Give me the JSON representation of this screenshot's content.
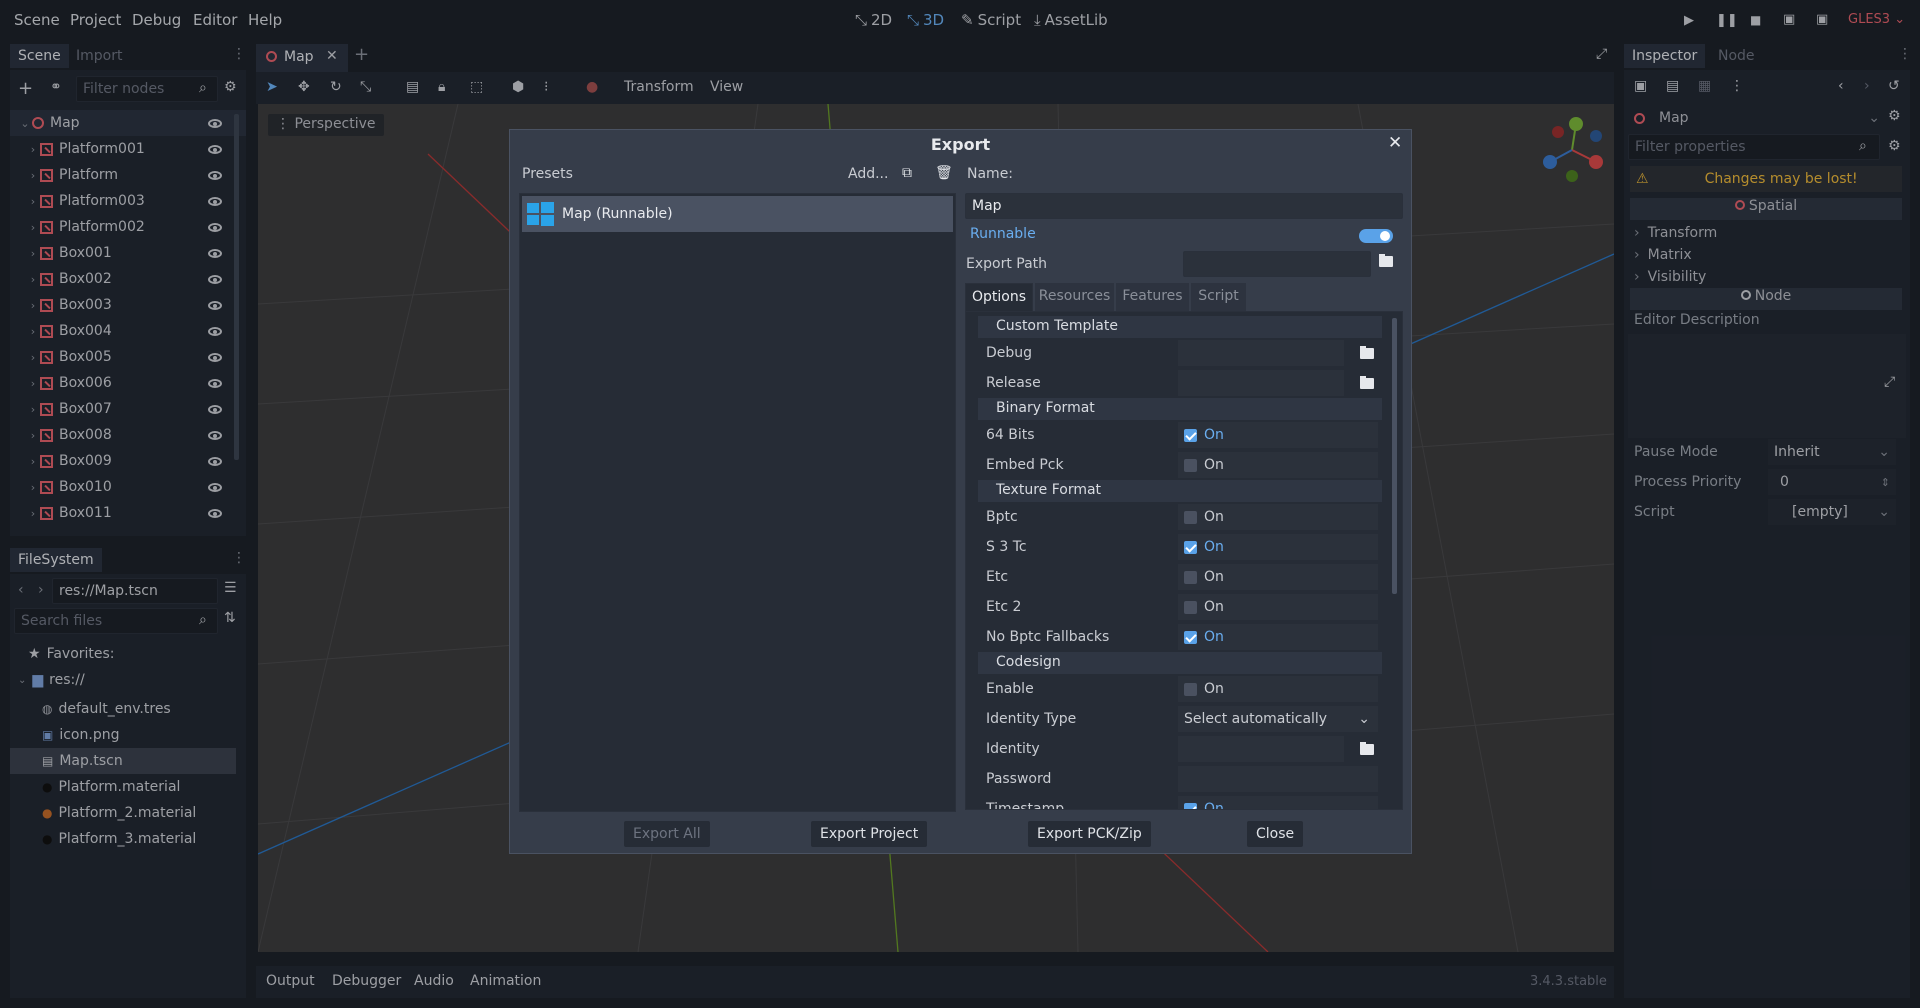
{
  "menubar": {
    "items": [
      "Scene",
      "Project",
      "Debug",
      "Editor",
      "Help"
    ],
    "modes": [
      "2D",
      "3D",
      "Script",
      "AssetLib"
    ],
    "renderer": "GLES3"
  },
  "scene_dock": {
    "tabs": [
      "Scene",
      "Import"
    ],
    "filter_placeholder": "Filter nodes",
    "nodes": [
      "Map",
      "Platform001",
      "Platform",
      "Platform003",
      "Platform002",
      "Box001",
      "Box002",
      "Box003",
      "Box004",
      "Box005",
      "Box006",
      "Box007",
      "Box008",
      "Box009",
      "Box010",
      "Box011"
    ]
  },
  "filesystem": {
    "tab": "FileSystem",
    "path": "res://Map.tscn",
    "search_placeholder": "Search files",
    "favorites": "Favorites:",
    "root": "res://",
    "files": [
      "default_env.tres",
      "icon.png",
      "Map.tscn",
      "Platform.material",
      "Platform_2.material",
      "Platform_3.material"
    ]
  },
  "editor": {
    "tab": "Map",
    "toolbar": [
      "Transform",
      "View"
    ],
    "viewport_label": "Perspective"
  },
  "export_dialog": {
    "title": "Export",
    "presets_label": "Presets",
    "add_label": "Add...",
    "preset_name": "Map (Runnable)",
    "name_label": "Name:",
    "name_value": "Map",
    "runnable_label": "Runnable",
    "export_path_label": "Export Path",
    "tabs": [
      "Options",
      "Resources",
      "Features",
      "Script"
    ],
    "sections": {
      "custom_template": "Custom Template",
      "binary_format": "Binary Format",
      "texture_format": "Texture Format",
      "codesign": "Codesign"
    },
    "debug": "Debug",
    "release": "Release",
    "options": [
      {
        "label": "64 Bits",
        "checked": true
      },
      {
        "label": "Embed Pck",
        "checked": false
      },
      {
        "label": "Bptc",
        "checked": false
      },
      {
        "label": "S 3 Tc",
        "checked": true
      },
      {
        "label": "Etc",
        "checked": false
      },
      {
        "label": "Etc 2",
        "checked": false
      },
      {
        "label": "No Bptc Fallbacks",
        "checked": true
      },
      {
        "label": "Enable",
        "checked": false
      },
      {
        "label": "Timestamp",
        "checked": true
      }
    ],
    "on_text": "On",
    "identity_type_label": "Identity Type",
    "identity_type_value": "Select automatically",
    "identity_label": "Identity",
    "password_label": "Password",
    "buttons": {
      "export_all": "Export All",
      "export_project": "Export Project",
      "export_pck": "Export PCK/Zip",
      "close": "Close"
    }
  },
  "inspector": {
    "tabs": [
      "Inspector",
      "Node"
    ],
    "object": "Map",
    "filter_placeholder": "Filter properties",
    "warning": "Changes may be lost!",
    "spatial": "Spatial",
    "groups": [
      "Transform",
      "Matrix",
      "Visibility"
    ],
    "node_section": "Node",
    "editor_description": "Editor Description",
    "pause_mode_label": "Pause Mode",
    "pause_mode_value": "Inherit",
    "process_priority_label": "Process Priority",
    "process_priority_value": "0",
    "script_label": "Script",
    "script_value": "[empty]"
  },
  "bottom": {
    "tabs": [
      "Output",
      "Debugger",
      "Audio",
      "Animation"
    ],
    "version": "3.4.3.stable"
  }
}
